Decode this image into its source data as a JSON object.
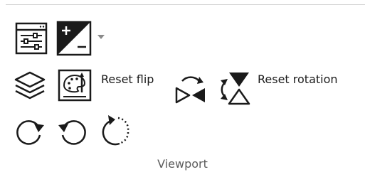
{
  "group": {
    "label": "Viewport"
  },
  "buttons": {
    "viewport_settings": {
      "icon": "sliders-panel-icon"
    },
    "window_level": {
      "icon": "plus-minus-contrast-icon"
    },
    "window_level_dropdown": {
      "icon": "chevron-down-icon"
    },
    "layers": {
      "icon": "layers-icon"
    },
    "paint_palette": {
      "icon": "palette-icon"
    },
    "reset_flip": {
      "label": "Reset flip",
      "icon": "flip-horizontal-icon"
    },
    "reset_rotation": {
      "label": "Reset rotation",
      "icon": "flip-vertical-icon"
    },
    "rotate_right": {
      "icon": "rotate-clockwise-icon"
    },
    "rotate_left": {
      "icon": "rotate-counterclockwise-icon"
    },
    "rotate_free": {
      "icon": "rotate-free-icon"
    }
  },
  "colors": {
    "icon_stroke": "#1a1a1a",
    "divider": "#d4d4d4",
    "dropdown_arrow": "#8a8a8a",
    "group_label": "#5b5b5b"
  }
}
